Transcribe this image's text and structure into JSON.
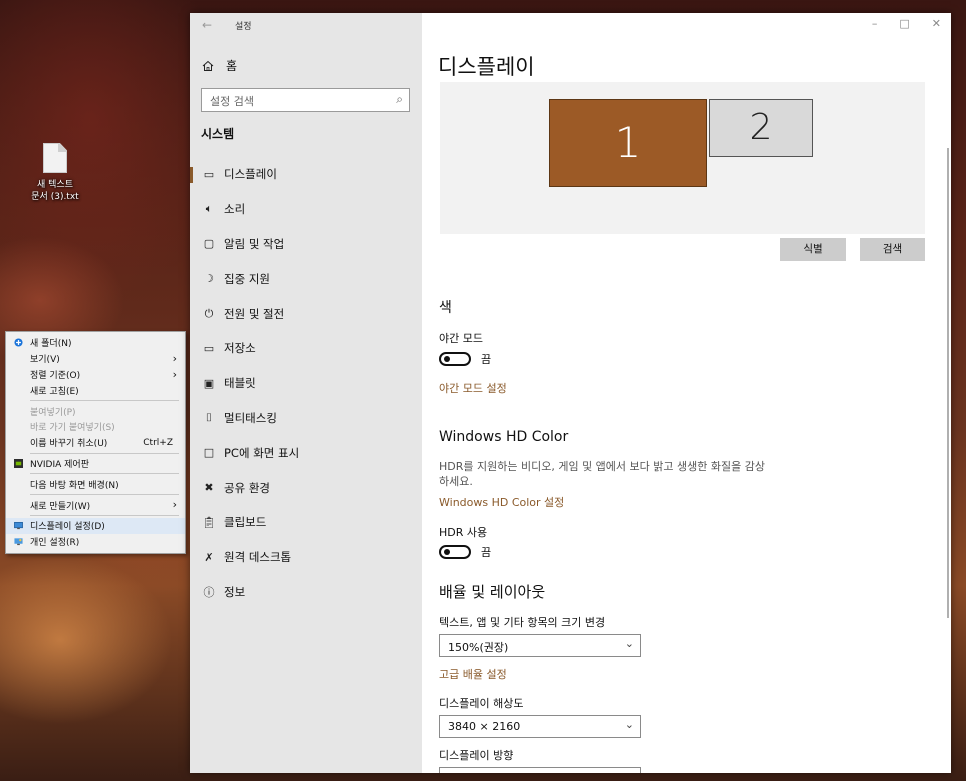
{
  "desktop": {
    "icon_label_line1": "새 텍스트",
    "icon_label_line2": "문서 (3).txt"
  },
  "context_menu": {
    "items": [
      {
        "label": "새 폴더(N)",
        "icon": "new-folder-icon"
      },
      {
        "label": "보기(V)",
        "submenu": true
      },
      {
        "label": "정렬 기준(O)",
        "submenu": true
      },
      {
        "label": "새로 고침(E)"
      },
      {
        "label": "붙여넣기(P)",
        "disabled": true
      },
      {
        "label": "바로 가기 붙여넣기(S)",
        "disabled": true
      },
      {
        "label": "이름 바꾸기 취소(U)",
        "accel": "Ctrl+Z"
      },
      {
        "label": "NVIDIA 제어판",
        "icon": "nvidia-icon"
      },
      {
        "label": "다음 바탕 화면 배경(N)"
      },
      {
        "label": "새로 만들기(W)",
        "submenu": true
      },
      {
        "label": "디스플레이 설정(D)",
        "icon": "display-settings-icon"
      },
      {
        "label": "개인 설정(R)",
        "icon": "personalize-icon"
      }
    ]
  },
  "window": {
    "title": "설정",
    "controls": {
      "minimize": "–",
      "maximize": "□",
      "close": "✕"
    }
  },
  "sidebar": {
    "home_label": "홈",
    "search_placeholder": "설정 검색",
    "section_title": "시스템",
    "items": [
      {
        "label": "디스플레이",
        "icon": "monitor-icon",
        "active": true
      },
      {
        "label": "소리",
        "icon": "speaker-icon"
      },
      {
        "label": "알림 및 작업",
        "icon": "notification-icon"
      },
      {
        "label": "집중 지원",
        "icon": "moon-icon"
      },
      {
        "label": "전원 및 절전",
        "icon": "power-icon"
      },
      {
        "label": "저장소",
        "icon": "storage-icon"
      },
      {
        "label": "태블릿",
        "icon": "tablet-icon"
      },
      {
        "label": "멀티태스킹",
        "icon": "multitasking-icon"
      },
      {
        "label": "PC에 화면 표시",
        "icon": "project-icon"
      },
      {
        "label": "공유 환경",
        "icon": "shared-icon"
      },
      {
        "label": "클립보드",
        "icon": "clipboard-icon"
      },
      {
        "label": "원격 데스크톱",
        "icon": "remote-icon"
      },
      {
        "label": "정보",
        "icon": "info-icon"
      }
    ]
  },
  "content": {
    "page_title": "디스플레이",
    "monitors": {
      "one": "1",
      "two": "2"
    },
    "identify_button": "식별",
    "detect_button": "검색",
    "color_section": "색",
    "night_mode_label": "야간 모드",
    "night_mode_state": "끔",
    "night_mode_link": "야간 모드 설정",
    "hdr_section": "Windows HD Color",
    "hdr_desc": "HDR를 지원하는 비디오, 게임 및 앱에서 보다 밝고 생생한 화질을 감상하세요.",
    "hdr_link": "Windows HD Color 설정",
    "hdr_use_label": "HDR 사용",
    "hdr_use_state": "끔",
    "layout_section": "배율 및 레이아웃",
    "scale_label": "텍스트, 앱 및 기타 항목의 크기 변경",
    "scale_value": "150%(권장)",
    "advanced_scale_link": "고급 배율 설정",
    "resolution_label": "디스플레이 해상도",
    "resolution_value": "3840 × 2160",
    "orientation_label": "디스플레이 방향"
  },
  "colors": {
    "accent": "#8a5a2b",
    "monitor_active": "#9c5a26"
  }
}
